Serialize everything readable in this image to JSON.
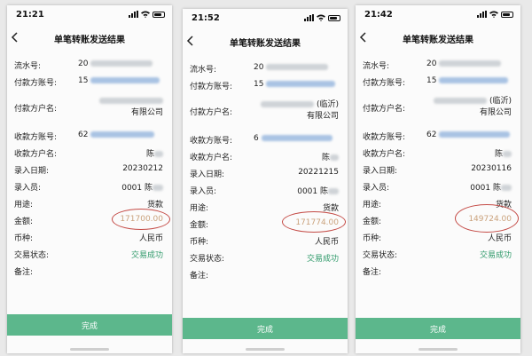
{
  "screens": [
    {
      "time": "21:21",
      "title": "单笔转账发送结果",
      "serial_prefix": "20",
      "payer_account_prefix": "15",
      "payer_name_line1": "",
      "payer_name_line2": "有限公司",
      "payee_account_prefix": "62",
      "payee_name": "陈",
      "entry_date": "20230212",
      "entry_user": "0001 陈",
      "purpose": "货款",
      "amount": "171700.00",
      "currency": "人民币",
      "status": "交易成功",
      "button": "完成"
    },
    {
      "time": "21:52",
      "title": "单笔转账发送结果",
      "serial_prefix": "20",
      "payer_account_prefix": "15",
      "payer_name_line1": "(临沂)",
      "payer_name_line2": "有限公司",
      "payee_account_prefix": "6",
      "payee_name": "陈",
      "entry_date": "20221215",
      "entry_user": "0001 陈",
      "purpose": "货款",
      "amount": "171774.00",
      "currency": "人民币",
      "status": "交易成功",
      "button": "完成"
    },
    {
      "time": "21:42",
      "title": "单笔转账发送结果",
      "serial_prefix": "20",
      "payer_account_prefix": "15",
      "payer_name_line1": "(临沂)",
      "payer_name_line2": "有限公司",
      "payee_account_prefix": "62",
      "payee_name": "陈",
      "entry_date": "20230116",
      "entry_user": "0001 陈",
      "purpose": "货款",
      "amount": "149724.00",
      "currency": "人民币",
      "status": "交易成功",
      "button": "完成"
    }
  ],
  "labels": {
    "serial": "流水号:",
    "payer_account": "付款方账号:",
    "payer_name": "付款方户名:",
    "payee_account": "收款方账号:",
    "payee_name": "收款方户名:",
    "entry_date": "录入日期:",
    "entry_user": "录入员:",
    "purpose": "用途:",
    "amount": "金额:",
    "currency": "币种:",
    "status": "交易状态:",
    "remark": "备注:"
  },
  "colors": {
    "success_green": "#2f9a6a",
    "button_green": "#5cb78c",
    "circle_red": "#c44a45"
  },
  "icons": {
    "back": "chevron-left-icon",
    "signal": "cellular-signal-icon",
    "wifi": "wifi-icon",
    "battery": "battery-icon"
  }
}
